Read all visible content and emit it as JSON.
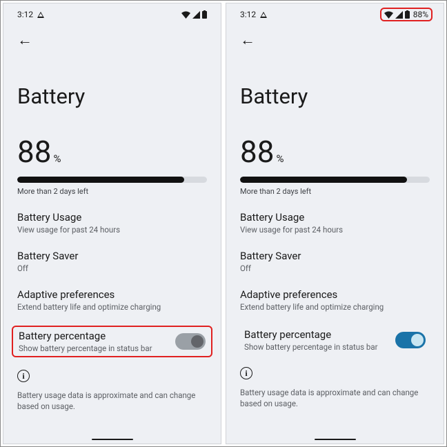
{
  "status": {
    "time": "3:12",
    "battery_pct_label": "88%"
  },
  "page": {
    "title": "Battery",
    "percent_value": "88",
    "percent_symbol": "%",
    "bar_fill_pct": 88,
    "estimate": "More than 2 days left"
  },
  "items": {
    "usage": {
      "title": "Battery Usage",
      "sub": "View usage for past 24 hours"
    },
    "saver": {
      "title": "Battery Saver",
      "sub": "Off"
    },
    "adaptive": {
      "title": "Adaptive preferences",
      "sub": "Extend battery life and optimize charging"
    },
    "percentage": {
      "title": "Battery percentage",
      "sub": "Show battery percentage in status bar"
    }
  },
  "disclaimer": "Battery usage data is approximate and can change based on usage."
}
